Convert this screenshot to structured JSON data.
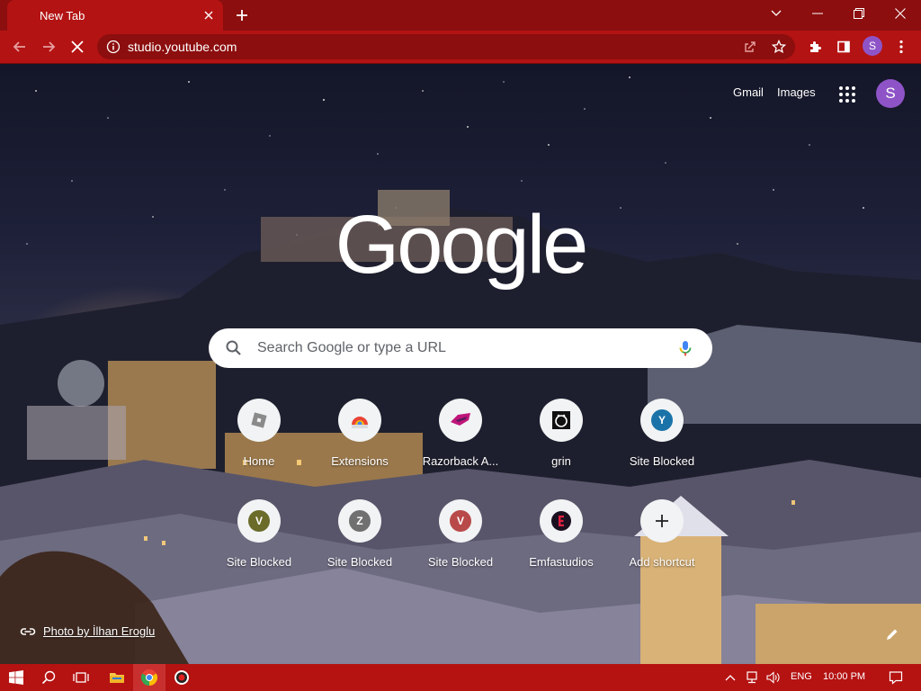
{
  "browser": {
    "tab": {
      "title": "New Tab"
    },
    "url": "studio.youtube.com",
    "profile_initial": "S"
  },
  "newtab": {
    "links": {
      "gmail": "Gmail",
      "images": "Images"
    },
    "profile_initial": "S",
    "search_placeholder": "Search Google or type a URL",
    "logo_text": "Google",
    "shortcuts": [
      {
        "label": "Home",
        "icon": "roblox-icon"
      },
      {
        "label": "Extensions",
        "icon": "chrome-web-store-icon"
      },
      {
        "label": "Razorback A...",
        "icon": "razorback-icon"
      },
      {
        "label": "grin",
        "icon": "grin-icon"
      },
      {
        "label": "Site Blocked",
        "letter": "Y",
        "color": "#1a73a8"
      },
      {
        "label": "Site Blocked",
        "letter": "V",
        "color": "#6b6b2a"
      },
      {
        "label": "Site Blocked",
        "letter": "Z",
        "color": "#707070"
      },
      {
        "label": "Site Blocked",
        "letter": "V",
        "color": "#b94a4a"
      },
      {
        "label": "Emfastudios",
        "icon": "emfastudios-icon"
      },
      {
        "label": "Add shortcut",
        "icon": "plus-icon"
      }
    ],
    "photo_credit": "Photo by İlhan Eroglu"
  },
  "taskbar": {
    "language": "ENG",
    "time": "10:00 PM"
  },
  "colors": {
    "chrome_dark": "#8c0e0e",
    "chrome": "#b31313",
    "taskbar": "#b51212",
    "avatar": "#8e54c7"
  }
}
